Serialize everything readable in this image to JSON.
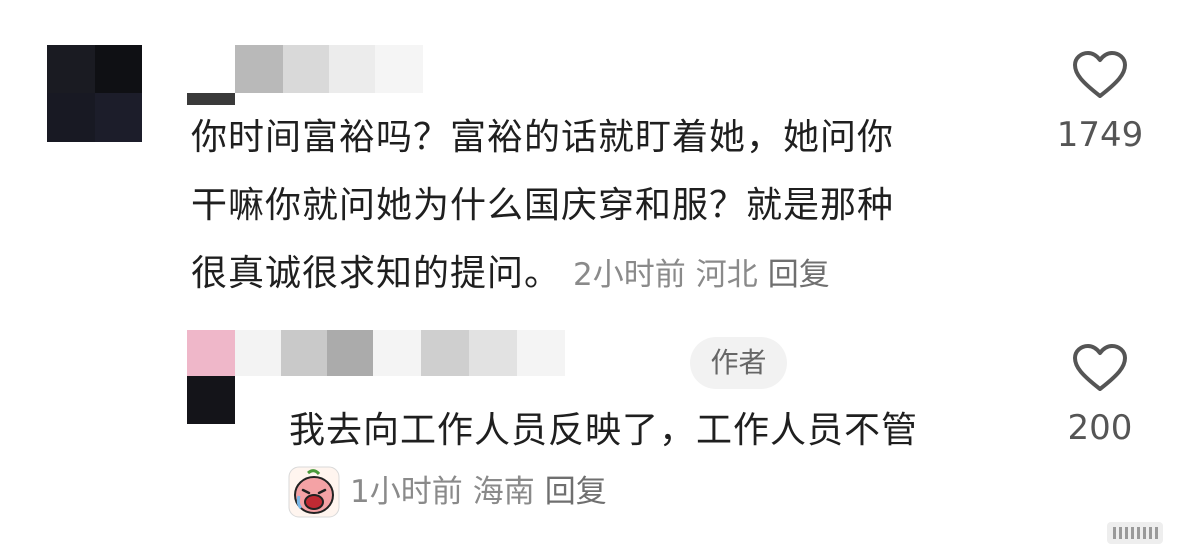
{
  "comments": [
    {
      "text_lines": [
        "你时间富裕吗？富裕的话就盯着她，她问你",
        "干嘛你就问她为什么国庆穿和服？就是那种",
        "很真诚很求知的提问。"
      ],
      "time": "2小时前",
      "location": "河北",
      "reply_label": "回复",
      "likes": "1749"
    },
    {
      "badge": "作者",
      "text": "我去向工作人员反映了，工作人员不管",
      "time": "1小时前",
      "location": "海南",
      "reply_label": "回复",
      "likes": "200"
    }
  ],
  "colors": {
    "text": "#1f1f1f",
    "meta": "#8a8a8a",
    "badge_bg": "#f2f2f2",
    "like_icon": "#555555"
  },
  "icons": {
    "like": "heart-outline-icon",
    "sticker": "crying-face-sticker-icon"
  }
}
